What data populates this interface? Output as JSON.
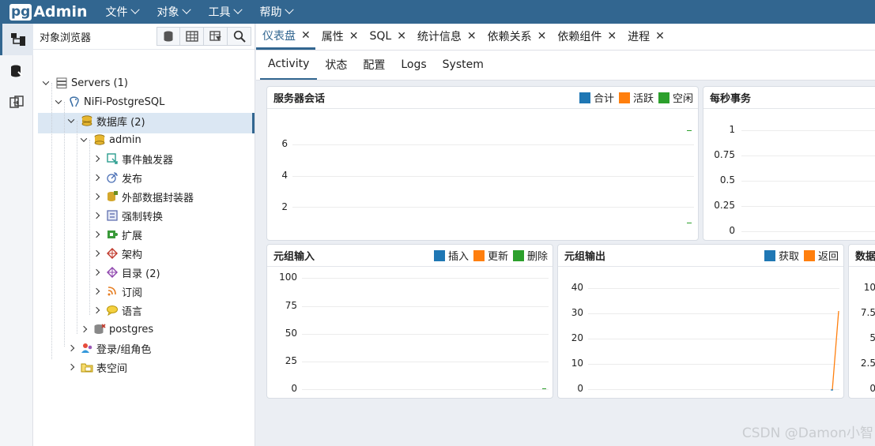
{
  "navbar": {
    "logo_pg": "pg",
    "logo_admin": "Admin",
    "menus": [
      "文件",
      "对象",
      "工具",
      "帮助"
    ]
  },
  "browser": {
    "title": "对象浏览器",
    "tree": [
      {
        "label": "Servers (1)",
        "icon": "servers-icon"
      },
      {
        "label": "NiFi-PostgreSQL",
        "icon": "elephant-icon"
      },
      {
        "label": "数据库 (2)",
        "icon": "databases-icon"
      },
      {
        "label": "admin",
        "icon": "database-icon"
      },
      {
        "label": "事件触发器",
        "icon": "event-trigger-icon"
      },
      {
        "label": "发布",
        "icon": "publication-icon"
      },
      {
        "label": "外部数据封装器",
        "icon": "fdw-icon"
      },
      {
        "label": "强制转换",
        "icon": "cast-icon"
      },
      {
        "label": "扩展",
        "icon": "extension-icon"
      },
      {
        "label": "架构",
        "icon": "schema-icon"
      },
      {
        "label": "目录 (2)",
        "icon": "catalog-icon"
      },
      {
        "label": "订阅",
        "icon": "subscription-icon"
      },
      {
        "label": "语言",
        "icon": "language-icon"
      },
      {
        "label": "postgres",
        "icon": "database-disconnected-icon"
      },
      {
        "label": "登录/组角色",
        "icon": "roles-icon"
      },
      {
        "label": "表空间",
        "icon": "tablespace-icon"
      }
    ]
  },
  "tabs": [
    "仪表盘",
    "属性",
    "SQL",
    "统计信息",
    "依赖关系",
    "依赖组件",
    "进程"
  ],
  "subtabs": [
    "Activity",
    "状态",
    "配置",
    "Logs",
    "System"
  ],
  "colors": {
    "blue": "#1f77b4",
    "orange": "#ff7f0e",
    "green": "#2ca02c"
  },
  "panels": {
    "sessions": {
      "title": "服务器会话",
      "legend": [
        "合计",
        "活跃",
        "空闲"
      ],
      "ticks": [
        "6",
        "4",
        "2"
      ]
    },
    "tps": {
      "title": "每秒事务",
      "ticks": [
        "1",
        "0.75",
        "0.5",
        "0.25",
        "0"
      ]
    },
    "tuples_in": {
      "title": "元组输入",
      "legend": [
        "插入",
        "更新",
        "删除"
      ],
      "ticks": [
        "100",
        "75",
        "50",
        "25",
        "0"
      ]
    },
    "tuples_out": {
      "title": "元组输出",
      "legend": [
        "获取",
        "返回"
      ],
      "ticks": [
        "40",
        "30",
        "20",
        "10",
        "0"
      ]
    },
    "block_io": {
      "title": "数据",
      "ticks": [
        "10",
        "7.5",
        "5",
        "2.5",
        "0"
      ]
    }
  },
  "watermark": "CSDN @Damon小智"
}
